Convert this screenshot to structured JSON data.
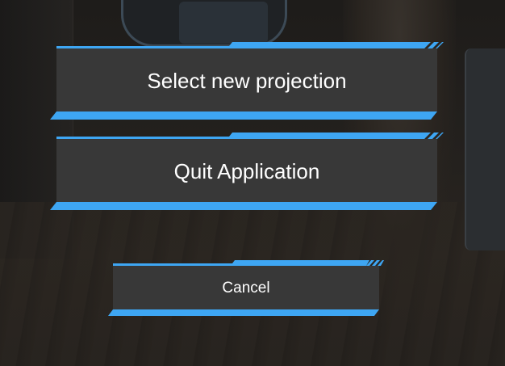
{
  "menu": {
    "buttons": [
      {
        "id": "select",
        "label": "Select new projection"
      },
      {
        "id": "quit",
        "label": "Quit Application"
      },
      {
        "id": "cancel",
        "label": "Cancel"
      }
    ]
  },
  "colors": {
    "accent": "#3ea6f3",
    "button_face": "#383838",
    "text": "#ffffff"
  }
}
